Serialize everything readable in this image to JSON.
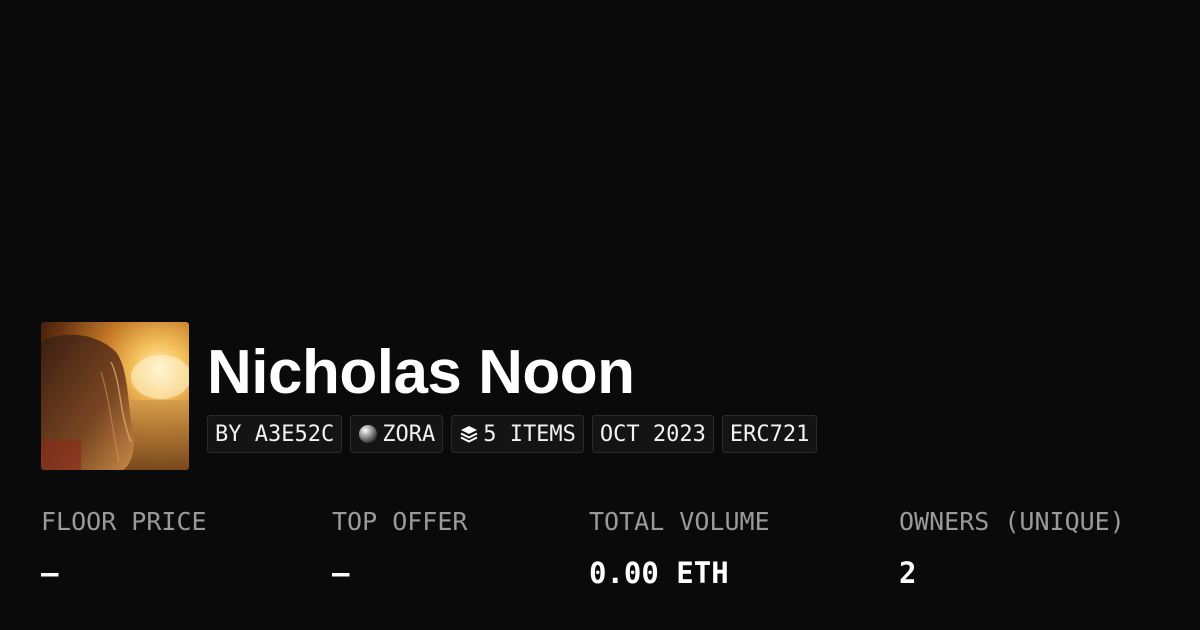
{
  "collection": {
    "title": "Nicholas Noon",
    "avatar_alt": "collection-avatar"
  },
  "chips": {
    "creator": "BY A3E52C",
    "network": "ZORA",
    "network_icon": "zora-orb-icon",
    "items": "5 ITEMS",
    "items_icon": "layers-icon",
    "date": "OCT 2023",
    "standard": "ERC721"
  },
  "stats": {
    "floor_price": {
      "label": "FLOOR PRICE",
      "value": "—"
    },
    "top_offer": {
      "label": "TOP OFFER",
      "value": "—"
    },
    "total_volume": {
      "label": "TOTAL VOLUME",
      "value": "0.00 ETH"
    },
    "owners": {
      "label": "OWNERS (UNIQUE)",
      "value": "2"
    }
  },
  "colors": {
    "background": "#0a0a0a",
    "chip_background": "#141414",
    "chip_border": "#2b2b2b",
    "label_gray": "#9a9a9a",
    "text": "#ffffff"
  }
}
